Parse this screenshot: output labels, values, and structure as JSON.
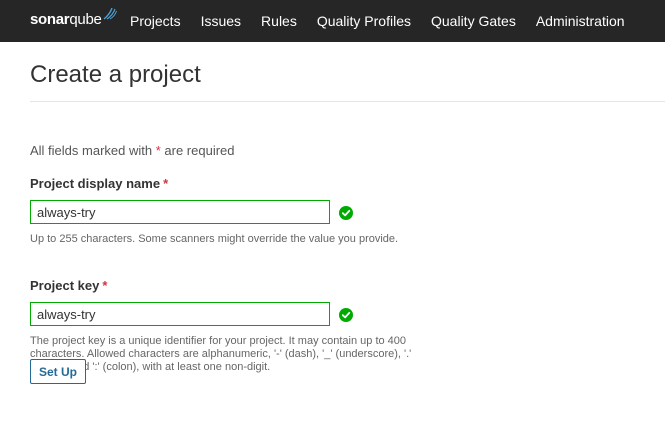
{
  "navbar": {
    "logo": {
      "bold": "sonar",
      "light": "qube"
    },
    "items": [
      "Projects",
      "Issues",
      "Rules",
      "Quality Profiles",
      "Quality Gates",
      "Administration"
    ]
  },
  "page": {
    "title": "Create a project",
    "required_note_prefix": "All fields marked with ",
    "required_star": "*",
    "required_note_suffix": " are required"
  },
  "fields": {
    "display_name": {
      "label": "Project display name",
      "star": "*",
      "value": "always-try",
      "help": "Up to 255 characters. Some scanners might override the value you provide."
    },
    "key": {
      "label": "Project key",
      "star": "*",
      "value": "always-try",
      "help": "The project key is a unique identifier for your project. It may contain up to 400 characters. Allowed characters are alphanumeric, '-' (dash), '_' (underscore), '.' (period) and ':' (colon), with at least one non-digit."
    }
  },
  "actions": {
    "setup_label": "Set Up"
  },
  "colors": {
    "nav_bg": "#262626",
    "valid": "#00aa00",
    "primary": "#236a97",
    "required": "#d4333f"
  }
}
